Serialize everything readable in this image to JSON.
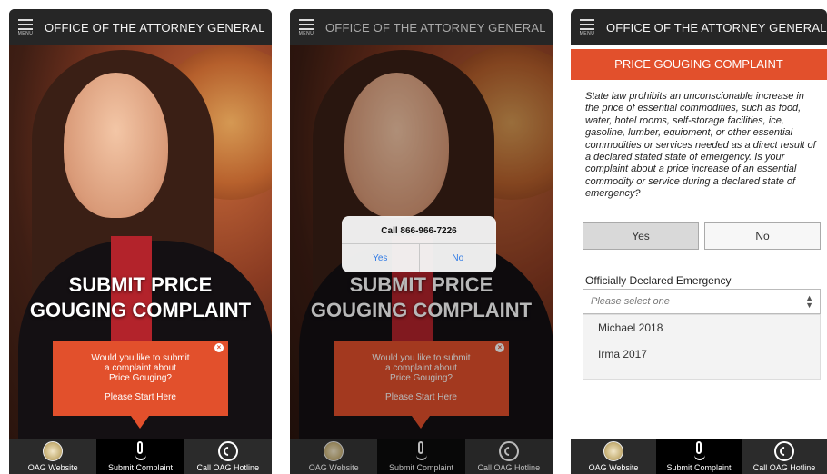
{
  "header": {
    "title": "OFFICE OF THE ATTORNEY GENERAL",
    "menu_label": "MENU"
  },
  "hero": {
    "headline_line1": "SUBMIT PRICE",
    "headline_line2": "GOUGING COMPLAINT"
  },
  "popup": {
    "line1": "Would you like to submit",
    "line2": "a complaint about",
    "line3": "Price Gouging?",
    "start": "Please Start Here",
    "close": "×"
  },
  "call_dialog": {
    "message": "Call 866-966-7226",
    "yes": "Yes",
    "no": "No"
  },
  "tabs": [
    {
      "label": "OAG Website",
      "icon": "seal-icon"
    },
    {
      "label": "Submit Complaint",
      "icon": "pen-icon"
    },
    {
      "label": "Call OAG Hotline",
      "icon": "phone-icon"
    }
  ],
  "complaint": {
    "title": "PRICE GOUGING COMPLAINT",
    "text": "State law prohibits an unconscionable increase in the price of essential commodities, such as food, water, hotel rooms, self-storage facilities, ice, gasoline, lumber, equipment, or other essential commodities or services needed as a direct result of a declared stated state of emergency. Is your complaint about a price increase of an essential commodity or service during a declared state of emergency?",
    "yes": "Yes",
    "no": "No",
    "emergency_label": "Officially Declared Emergency",
    "select_placeholder": "Please select one",
    "options": [
      "Michael 2018",
      "Irma 2017"
    ]
  },
  "colors": {
    "accent": "#e2502c",
    "topbar": "#262626",
    "link": "#2f7ae5"
  }
}
